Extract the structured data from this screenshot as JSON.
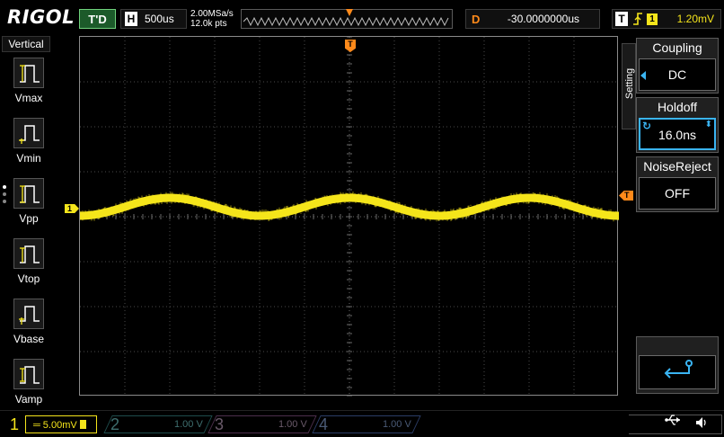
{
  "brand": {
    "logo": "RIGOL"
  },
  "topbar": {
    "run_status": "T'D",
    "horizontal_label": "H",
    "timebase": "500us",
    "sample_rate": "2.00MSa/s",
    "memory_depth": "12.0k pts",
    "delay_label": "D",
    "delay_value": "-30.0000000us",
    "trigger_label": "T",
    "trigger_edge_icon": "rising-edge-icon",
    "trigger_source": "1",
    "trigger_level": "1.20mV"
  },
  "left_menu": {
    "title": "Vertical",
    "items": [
      {
        "label": "Vmax",
        "icon": "vmax-icon"
      },
      {
        "label": "Vmin",
        "icon": "vmin-icon"
      },
      {
        "label": "Vpp",
        "icon": "vpp-icon"
      },
      {
        "label": "Vtop",
        "icon": "vtop-icon"
      },
      {
        "label": "Vbase",
        "icon": "vbase-icon"
      },
      {
        "label": "Vamp",
        "icon": "vamp-icon"
      }
    ]
  },
  "screen": {
    "ch1_marker": "1",
    "trigger_pos_marker": "T",
    "trigger_level_marker": "T",
    "waveform_color": "#f5e51b"
  },
  "right_menu": {
    "tab_label": "Setting",
    "coupling": {
      "title": "Coupling",
      "value": "DC"
    },
    "holdoff": {
      "title": "Holdoff",
      "value": "16.0ns"
    },
    "noise_reject": {
      "title": "NoiseReject",
      "value": "OFF"
    },
    "back_icon": "return-icon"
  },
  "bottombar": {
    "channels": [
      {
        "num": "1",
        "scale": "5.00mV",
        "color": "#f5e51b"
      },
      {
        "num": "2",
        "scale": "1.00 V",
        "color": "#3f6f6f"
      },
      {
        "num": "3",
        "scale": "1.00 V",
        "color": "#6a5a6a"
      },
      {
        "num": "4",
        "scale": "1.00 V",
        "color": "#4a5a76"
      }
    ],
    "usb_icon": "usb-icon",
    "speaker_icon": "speaker-icon"
  }
}
